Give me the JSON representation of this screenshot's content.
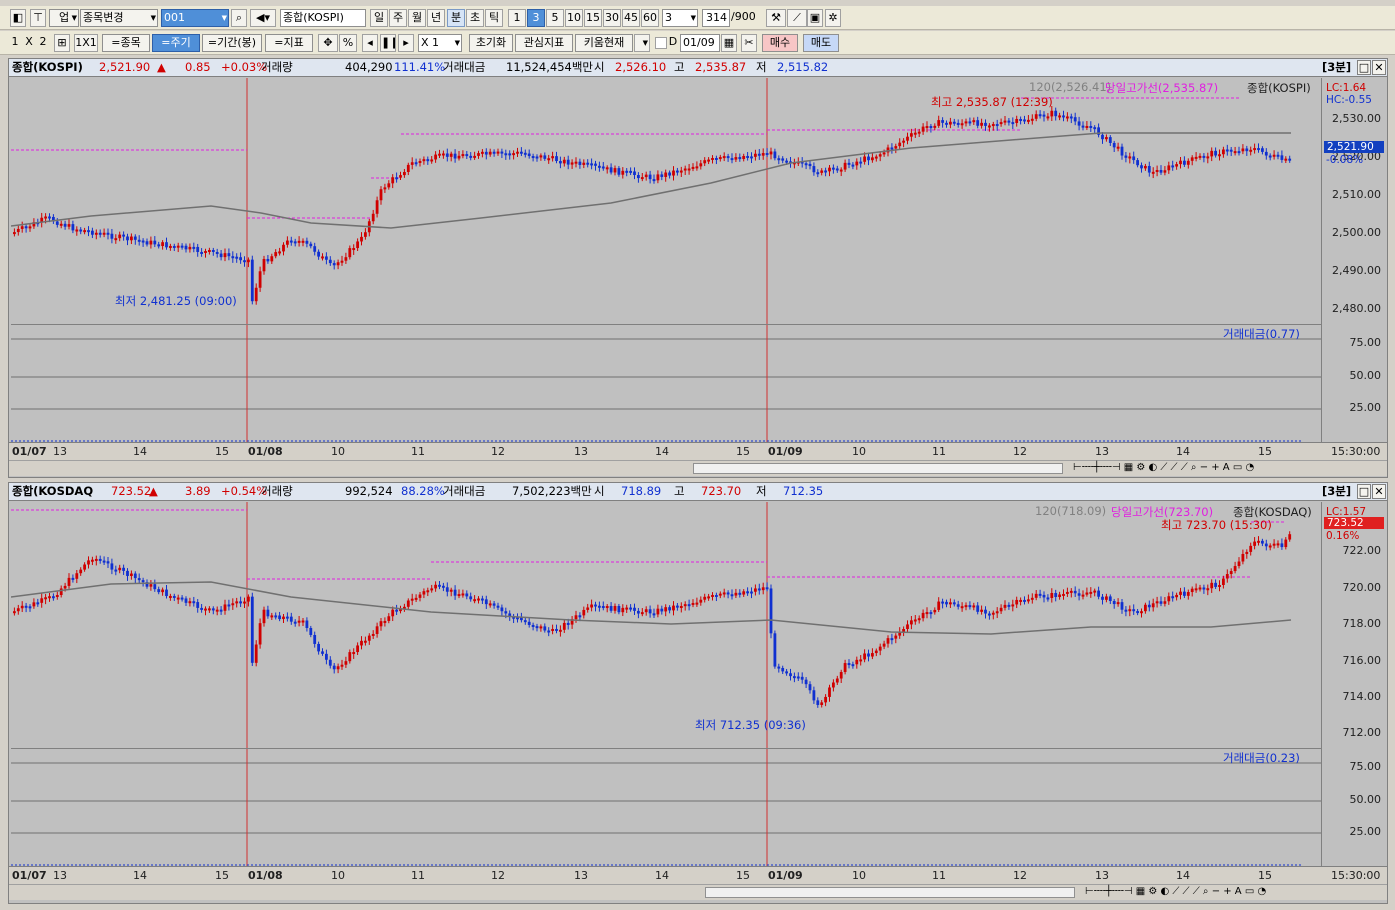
{
  "toolbar1": {
    "menu": "업",
    "stock_change": "종목변경",
    "code_input": "001",
    "index_name": "종합(KOSPI)",
    "period_buttons": [
      "일",
      "주",
      "월",
      "년",
      "분",
      "초",
      "틱"
    ],
    "selected_period": "분",
    "minute_buttons": [
      "1",
      "3",
      "5",
      "10",
      "15",
      "30",
      "45",
      "60"
    ],
    "selected_minute": "3",
    "unit_value": "3",
    "count_value": "314",
    "count_max": "/900"
  },
  "toolbar2": {
    "layout_1": "1",
    "layout_x": "X",
    "layout_2": "2",
    "one_by_one": "1X1",
    "stock_btn": "=종목",
    "period_btn": "=주기",
    "range_btn": "=기간(봉)",
    "indicator_btn": "=지표",
    "percent": "%",
    "multiplier": "X 1",
    "reset_btn": "초기화",
    "interest_btn": "관심지표",
    "kiwoom_btn": "키움현재",
    "d_label": "D",
    "date_value": "01/09",
    "buy_btn": "매수",
    "sell_btn": "매도"
  },
  "kospi": {
    "name": "종합(KOSPI)",
    "price": "2,521.90",
    "arrow": "▲",
    "change": "0.85",
    "change_pct": "+0.03%",
    "volume_label": "거래량",
    "volume": "404,290",
    "volume_pct": "111.41%",
    "amount_label": "거래대금",
    "amount": "11,524,454백만",
    "open_label": "시",
    "open": "2,526.10",
    "high_label": "고",
    "high": "2,535.87",
    "low_label": "저",
    "low": "2,515.82",
    "interval": "[3분]",
    "ma_label": "120(2,526.41)",
    "day_high_line": "당일고가선(2,535.87)",
    "series_label": "종합(KOSPI)",
    "lc": "LC:1.64",
    "hc": "HC:-0.55",
    "current_tag": "2,521.90",
    "current_pct": "-0.08%",
    "max_ann": "최고 2,535.87 (12:39)",
    "min_ann": "최저 2,481.25 (09:00)",
    "sub_label": "거래대금(0.77)",
    "y_ticks": [
      "2,530.00",
      "2,520.00",
      "2,510.00",
      "2,500.00",
      "2,490.00",
      "2,480.00"
    ],
    "sub_ticks": [
      "75.00",
      "50.00",
      "25.00"
    ],
    "time_end": "15:30:00",
    "x_labels": [
      "01/07",
      "13",
      "14",
      "15",
      "01/08",
      "10",
      "11",
      "12",
      "13",
      "14",
      "15",
      "01/09",
      "10",
      "11",
      "12",
      "13",
      "14",
      "15"
    ]
  },
  "kosdaq": {
    "name": "종합(KOSDAQ",
    "price": "723.52",
    "arrow": "▲",
    "change": "3.89",
    "change_pct": "+0.54%",
    "volume_label": "거래량",
    "volume": "992,524",
    "volume_pct": "88.28%",
    "amount_label": "거래대금",
    "amount": "7,502,223백만",
    "open_label": "시",
    "open": "718.89",
    "high_label": "고",
    "high": "723.70",
    "low_label": "저",
    "low": "712.35",
    "interval": "[3분]",
    "ma_label": "120(718.09)",
    "day_high_line": "당일고가선(723.70)",
    "series_label": "종합(KOSDAQ)",
    "lc": "LC:1.57",
    "current_tag": "723.52",
    "current_pct": "0.16%",
    "max_ann": "최고 723.70 (15:30)",
    "min_ann": "최저 712.35 (09:36)",
    "sub_label": "거래대금(0.23)",
    "y_ticks": [
      "722.00",
      "720.00",
      "718.00",
      "716.00",
      "714.00",
      "712.00"
    ],
    "sub_ticks": [
      "75.00",
      "50.00",
      "25.00"
    ],
    "time_end": "15:30:00",
    "x_labels": [
      "01/07",
      "13",
      "14",
      "15",
      "01/08",
      "10",
      "11",
      "12",
      "13",
      "14",
      "15",
      "01/09",
      "10",
      "11",
      "12",
      "13",
      "14",
      "15"
    ]
  },
  "colors": {
    "up": "#d00000",
    "down": "#1030d0",
    "ma": "#707070",
    "day_high": "#e020e0",
    "session": "#d03030"
  }
}
